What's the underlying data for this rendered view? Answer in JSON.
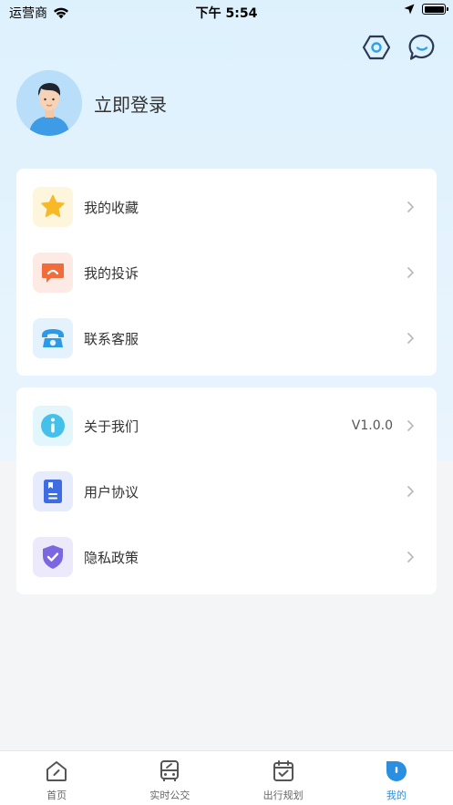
{
  "status_bar": {
    "carrier": "运营商",
    "time": "下午 5:54"
  },
  "header": {
    "settings_icon": "hexagon-settings-icon",
    "message_icon": "chat-bubble-icon"
  },
  "profile": {
    "login_text": "立即登录"
  },
  "menu_group_1": [
    {
      "label": "我的收藏",
      "icon": "star-icon",
      "icon_bg": "#fef6dc",
      "icon_color": "#f7b928"
    },
    {
      "label": "我的投诉",
      "icon": "complaint-icon",
      "icon_bg": "#fdeae4",
      "icon_color": "#f26b3a"
    },
    {
      "label": "联系客服",
      "icon": "telephone-icon",
      "icon_bg": "#e4f2fd",
      "icon_color": "#2d9ae8"
    }
  ],
  "menu_group_2": [
    {
      "label": "关于我们",
      "value": "V1.0.0",
      "icon": "info-icon",
      "icon_bg": "#e2f6fc",
      "icon_color": "#45c0ea"
    },
    {
      "label": "用户协议",
      "icon": "document-icon",
      "icon_bg": "#e6ecfc",
      "icon_color": "#3d6de0"
    },
    {
      "label": "隐私政策",
      "icon": "shield-check-icon",
      "icon_bg": "#ece9fb",
      "icon_color": "#7b68e0"
    }
  ],
  "tabs": [
    {
      "label": "首页",
      "icon": "home-icon",
      "active": false
    },
    {
      "label": "实时公交",
      "icon": "bus-icon",
      "active": false
    },
    {
      "label": "出行规划",
      "icon": "calendar-check-icon",
      "active": false
    },
    {
      "label": "我的",
      "icon": "profile-tab-icon",
      "active": true
    }
  ],
  "colors": {
    "accent": "#2a8fe0",
    "tab_inactive": "#666666"
  }
}
